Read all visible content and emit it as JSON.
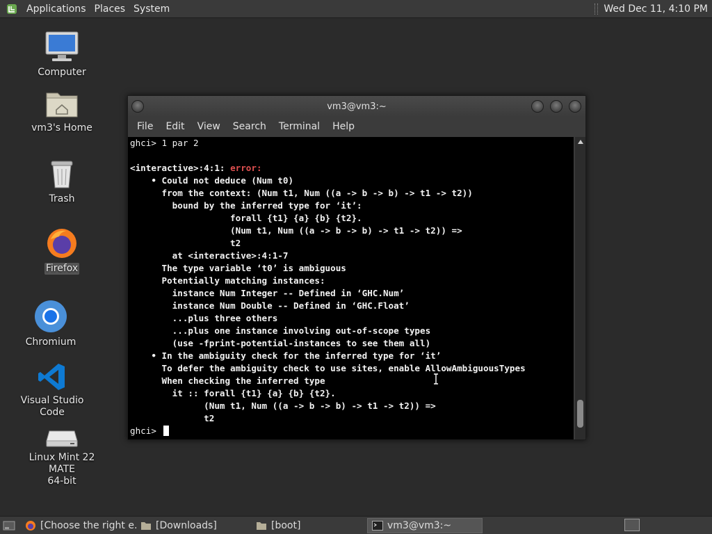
{
  "top_panel": {
    "menus": [
      "Applications",
      "Places",
      "System"
    ],
    "clock": "Wed Dec 11,  4:10 PM"
  },
  "desktop": {
    "icons": [
      {
        "label": "Computer",
        "icon": "computer-icon"
      },
      {
        "label": "vm3's Home",
        "icon": "home-folder-icon"
      },
      {
        "label": "Trash",
        "icon": "trash-icon"
      },
      {
        "label": "Firefox",
        "icon": "firefox-icon"
      },
      {
        "label": "Chromium",
        "icon": "chromium-icon"
      },
      {
        "label": "Visual Studio Code",
        "icon": "vscode-icon"
      },
      {
        "label": "Linux Mint 22 MATE\n64-bit",
        "icon": "drive-icon"
      }
    ]
  },
  "terminal": {
    "title": "vm3@vm3:~",
    "menus": [
      "File",
      "Edit",
      "View",
      "Search",
      "Terminal",
      "Help"
    ],
    "prompt_cmd": "ghci> 1 par 2",
    "error_location": "<interactive>:4:1: ",
    "error_word": "error:",
    "lines": [
      "    • Could not deduce (Num t0)",
      "      from the context: (Num t1, Num ((a -> b -> b) -> t1 -> t2))",
      "        bound by the inferred type for ‘it’:",
      "                   forall {t1} {a} {b} {t2}.",
      "                   (Num t1, Num ((a -> b -> b) -> t1 -> t2)) =>",
      "                   t2",
      "        at <interactive>:4:1-7",
      "      The type variable ‘t0’ is ambiguous",
      "      Potentially matching instances:",
      "        instance Num Integer -- Defined in ‘GHC.Num’",
      "        instance Num Double -- Defined in ‘GHC.Float’",
      "        ...plus three others",
      "        ...plus one instance involving out-of-scope types",
      "        (use -fprint-potential-instances to see them all)",
      "    • In the ambiguity check for the inferred type for ‘it’",
      "      To defer the ambiguity check to use sites, enable AllowAmbiguousTypes",
      "      When checking the inferred type",
      "        it :: forall {t1} {a} {b} {t2}.",
      "              (Num t1, Num ((a -> b -> b) -> t1 -> t2)) =>",
      "              t2"
    ],
    "final_prompt": "ghci> "
  },
  "taskbar": {
    "items": [
      {
        "label": "[Choose the right e...",
        "icon": "firefox-icon",
        "active": false
      },
      {
        "label": "[Downloads]",
        "icon": "folder-icon",
        "active": false
      },
      {
        "label": "[boot]",
        "icon": "folder-icon",
        "active": false
      },
      {
        "label": "vm3@vm3:~",
        "icon": "terminal-icon",
        "active": true
      }
    ]
  },
  "colors": {
    "desktop_bg": "#2b2b2b",
    "panel_bg": "#3a3a3a",
    "terminal_bg": "#000000",
    "error_red": "#e05050"
  }
}
